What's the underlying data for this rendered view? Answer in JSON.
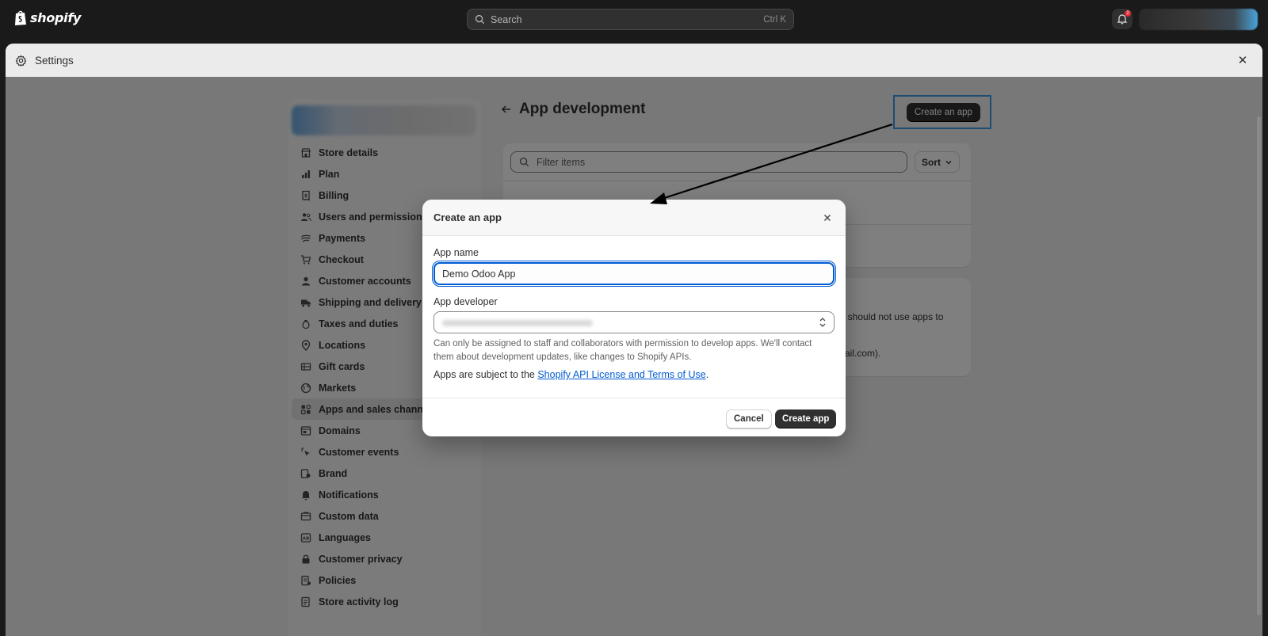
{
  "topbar": {
    "brand": "shopify",
    "search_placeholder": "Search",
    "search_shortcut": "Ctrl K",
    "notification_count": "2"
  },
  "window": {
    "title": "Settings",
    "close": "✕"
  },
  "sidebar": {
    "items": [
      {
        "label": "Store details",
        "icon": "store-icon"
      },
      {
        "label": "Plan",
        "icon": "chart-icon"
      },
      {
        "label": "Billing",
        "icon": "receipt-icon"
      },
      {
        "label": "Users and permissions",
        "icon": "users-icon"
      },
      {
        "label": "Payments",
        "icon": "payments-icon"
      },
      {
        "label": "Checkout",
        "icon": "cart-icon"
      },
      {
        "label": "Customer accounts",
        "icon": "person-icon"
      },
      {
        "label": "Shipping and delivery",
        "icon": "truck-icon"
      },
      {
        "label": "Taxes and duties",
        "icon": "money-bag-icon"
      },
      {
        "label": "Locations",
        "icon": "location-icon"
      },
      {
        "label": "Gift cards",
        "icon": "gift-card-icon"
      },
      {
        "label": "Markets",
        "icon": "globe-icon"
      },
      {
        "label": "Apps and sales channels",
        "icon": "apps-icon"
      },
      {
        "label": "Domains",
        "icon": "domain-icon"
      },
      {
        "label": "Customer events",
        "icon": "cursor-icon"
      },
      {
        "label": "Brand",
        "icon": "brand-icon"
      },
      {
        "label": "Notifications",
        "icon": "bell-icon"
      },
      {
        "label": "Custom data",
        "icon": "database-icon"
      },
      {
        "label": "Languages",
        "icon": "language-icon"
      },
      {
        "label": "Customer privacy",
        "icon": "lock-icon"
      },
      {
        "label": "Policies",
        "icon": "policy-icon"
      },
      {
        "label": "Store activity log",
        "icon": "activity-icon"
      }
    ],
    "active_index": 12
  },
  "main": {
    "title": "App development",
    "create_button": "Create an app",
    "filter_placeholder": "Filter items",
    "sort_label": "Sort",
    "card2_text1": "ou should not use apps to",
    "card2_text2": "mail.com)."
  },
  "modal": {
    "title": "Create an app",
    "app_name_label": "App name",
    "app_name_value": "Demo Odoo App",
    "app_developer_label": "App developer",
    "help_text": "Can only be assigned to staff and collaborators with permission to develop apps. We'll contact them about development updates, like changes to Shopify APIs.",
    "terms_prefix": "Apps are subject to the ",
    "terms_link": "Shopify API License and Terms of Use",
    "terms_suffix": ".",
    "cancel_button": "Cancel",
    "create_button": "Create app"
  },
  "colors": {
    "highlight": "#3d9ae8",
    "focus": "#005bd3",
    "primary_button": "#303030"
  }
}
